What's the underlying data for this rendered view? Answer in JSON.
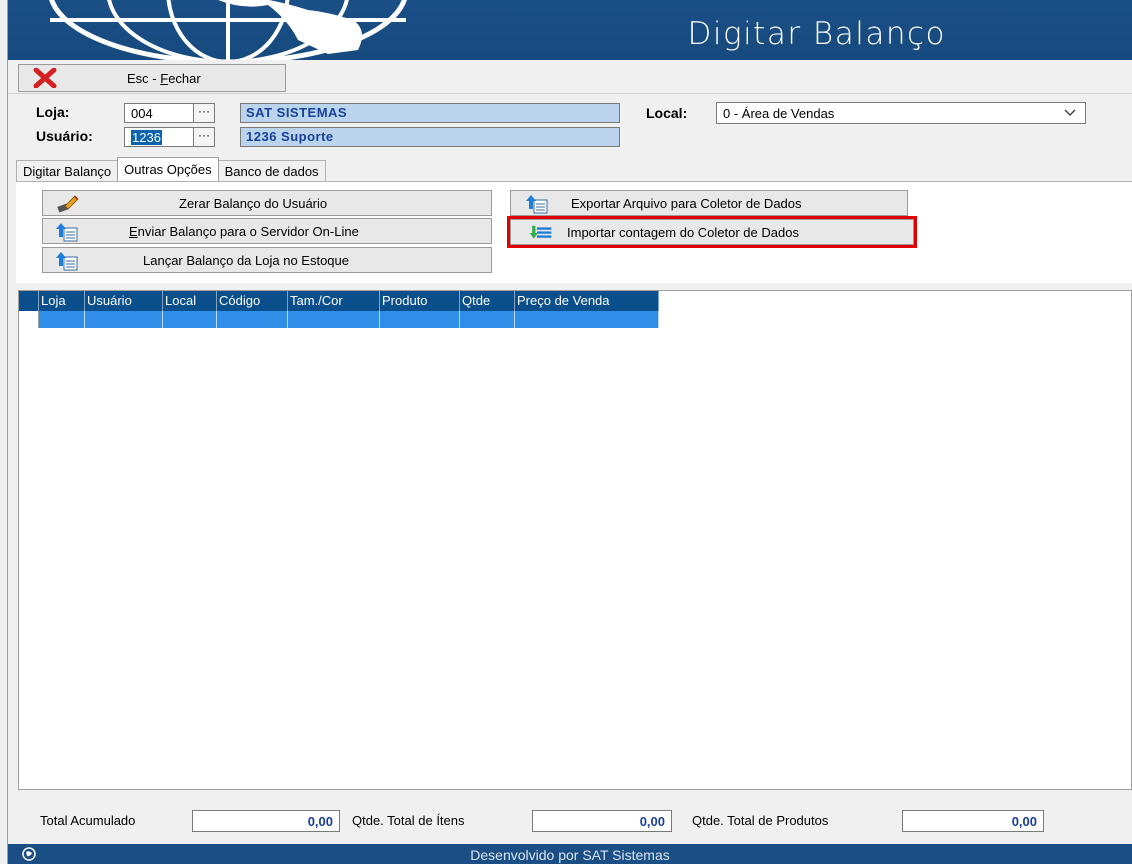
{
  "banner": {
    "title": "Digitar Balanço"
  },
  "toolbar": {
    "close_label_prefix": "Esc - ",
    "close_label_key": "F",
    "close_label_rest": "echar"
  },
  "header": {
    "loja_label": "Loja:",
    "loja_code": "004",
    "loja_name": "SAT SISTEMAS",
    "usuario_label": "Usuário:",
    "usuario_code": "1236",
    "usuario_name": "1236 Suporte",
    "lookup_label": "···",
    "local_label": "Local:",
    "local_value": "0 - Área de Vendas"
  },
  "tabs": [
    {
      "label": "Digitar Balanço"
    },
    {
      "label": "Outras Opções"
    },
    {
      "label": "Banco de dados"
    }
  ],
  "actions": {
    "zerar": "Zerar Balanço do Usuário",
    "enviar_key": "E",
    "enviar_rest": "nviar Balanço para o Servidor On-Line",
    "lancar": "Lançar Balanço da Loja no Estoque",
    "exportar": "Exportar Arquivo para Coletor de Dados",
    "importar": "Importar contagem do Coletor de Dados"
  },
  "grid": {
    "columns": [
      "Loja",
      "Usuário",
      "Local",
      "Código",
      "Tam./Cor",
      "Produto",
      "Qtde",
      "Preço de Venda"
    ]
  },
  "footer": {
    "total_acumulado_label": "Total Acumulado",
    "total_acumulado_value": "0,00",
    "qtde_itens_label": "Qtde. Total de Ítens",
    "qtde_itens_value": "0,00",
    "qtde_produtos_label": "Qtde. Total de Produtos",
    "qtde_produtos_value": "0,00"
  },
  "status_bar": {
    "text": "Desenvolvido por SAT Sistemas"
  },
  "colors": {
    "brand_blue": "#1a4f86",
    "highlight_red": "#e00000",
    "grid_select": "#2e8ee8"
  }
}
